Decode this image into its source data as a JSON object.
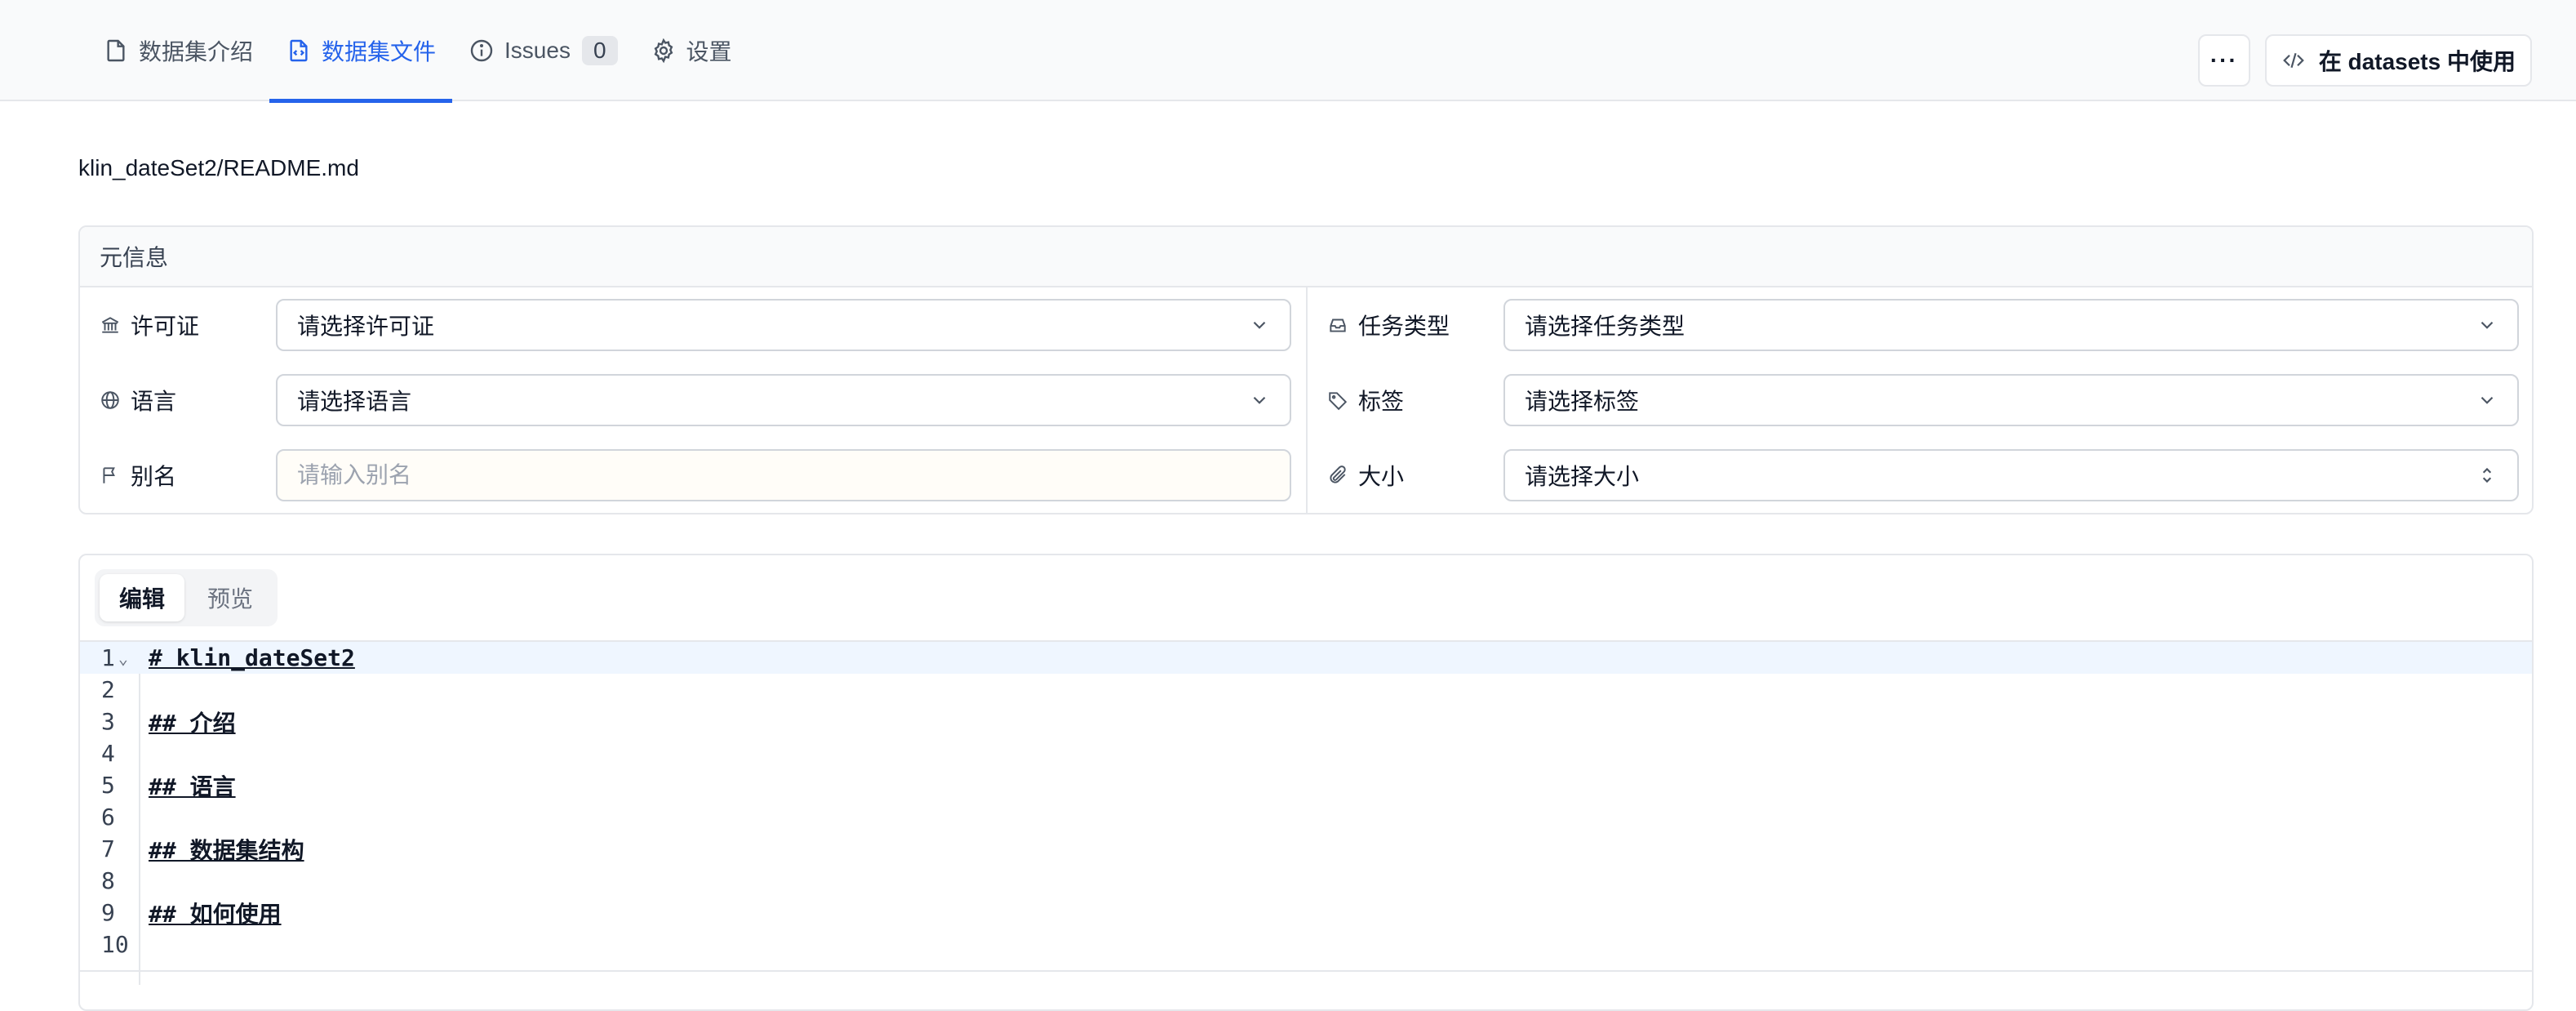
{
  "tabs": [
    {
      "label": "数据集介绍",
      "icon": "file-icon"
    },
    {
      "label": "数据集文件",
      "icon": "file-code-icon"
    },
    {
      "label": "Issues",
      "icon": "info-circle-icon",
      "count": "0"
    },
    {
      "label": "设置",
      "icon": "gear-icon"
    }
  ],
  "actions": {
    "more_label": "···",
    "use_label": "在 datasets 中使用"
  },
  "file_path": "klin_dateSet2/README.md",
  "meta": {
    "title": "元信息",
    "license": {
      "label": "许可证",
      "value": "请选择许可证"
    },
    "task_type": {
      "label": "任务类型",
      "value": "请选择任务类型"
    },
    "language": {
      "label": "语言",
      "value": "请选择语言"
    },
    "tags": {
      "label": "标签",
      "value": "请选择标签"
    },
    "alias": {
      "label": "别名",
      "placeholder": "请输入别名"
    },
    "size": {
      "label": "大小",
      "value": "请选择大小"
    }
  },
  "editor": {
    "modes": {
      "edit": "编辑",
      "preview": "预览"
    },
    "lines": [
      {
        "n": "1",
        "text": "# klin_dateSet2"
      },
      {
        "n": "2",
        "text": ""
      },
      {
        "n": "3",
        "text": "## 介绍"
      },
      {
        "n": "4",
        "text": ""
      },
      {
        "n": "5",
        "text": "## 语言"
      },
      {
        "n": "6",
        "text": ""
      },
      {
        "n": "7",
        "text": "## 数据集结构"
      },
      {
        "n": "8",
        "text": ""
      },
      {
        "n": "9",
        "text": "## 如何使用"
      },
      {
        "n": "10",
        "text": ""
      }
    ],
    "fold_marker": "⌄"
  },
  "colors": {
    "accent": "#2563eb",
    "active_line": "#eff6ff",
    "border": "#e5e7eb"
  }
}
